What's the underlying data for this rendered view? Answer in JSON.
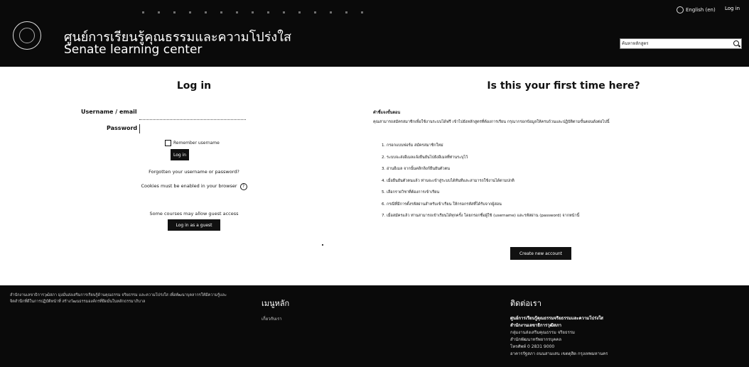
{
  "header": {
    "title_th": "ศูนย์การเรียนรู้คุณธรรมและความโปร่งใส",
    "title_en": "Senate learning center",
    "language": "English (en)",
    "login": "Log in",
    "search_placeholder": "ค้นหาหลักสูตร"
  },
  "login": {
    "heading": "Log in",
    "username_label": "Username / email",
    "password_label": "Password",
    "remember": "Remember username",
    "button": "Log in",
    "forgot": "Forgotten your username or password?",
    "cookies": "Cookies must be enabled in your browser",
    "guest_note": "Some courses may allow guest access",
    "guest_button": "Log in as a guest"
  },
  "signup": {
    "heading": "Is this your first time here?",
    "instructions_title": "คำชี้แจงขั้นตอน",
    "intro": "คุณสามารถสมัครสมาชิกเพื่อใช้งานระบบได้ฟรี เข้าไปยังหลักสูตรที่ต้องการเรียน กรุณากรอกข้อมูลให้ครบถ้วนและปฏิบัติตามขั้นตอนดังต่อไปนี้",
    "steps": [
      "1. กรอกแบบฟอร์ม สมัครสมาชิกใหม่",
      "2. ระบบจะส่งอีเมลแจ้งยืนยันไปยังอีเมลที่ท่านระบุไว้",
      "3. อ่านอีเมล จากนั้นคลิกลิงก์ยืนยันตัวตน",
      "4. เมื่อยืนยันตัวตนแล้ว ท่านจะเข้าสู่ระบบได้ทันทีและสามารถใช้งานได้ตามปกติ",
      "5. เลือกรายวิชาที่ต้องการเข้าเรียน",
      "6. กรณีที่มีการตั้งรหัสผ่านสำหรับเข้าเรียน ให้กรอกรหัสที่ได้รับจากผู้สอน",
      "7. เมื่อสมัครแล้ว ท่านสามารถเข้าเรียนได้ทุกครั้ง โดยกรอกชื่อผู้ใช้ (username) และรหัสผ่าน (password) จากหน้านี้"
    ],
    "button": "Create new account"
  },
  "footer": {
    "about": "สำนักงานเลขาธิการวุฒิสภา มุ่งมั่นส่งเสริมการเรียนรู้ด้านคุณธรรม จริยธรรม และความโปร่งใส เพื่อพัฒนาบุคลากรให้มีความรู้และจิตสำนึกที่ดีในการปฏิบัติหน้าที่ สร้างวัฒนธรรมองค์กรที่ยึดมั่นในหลักธรรมาภิบาล",
    "menu_heading": "เมนูหลัก",
    "menu_item": "เกี่ยวกับเรา",
    "contact_heading": "ติดต่อเรา",
    "contact_name": "ศูนย์การเรียนรู้คุณธรรมจริยธรรมและความโปร่งใส",
    "contact_org": "สำนักงานเลขาธิการวุฒิสภา",
    "contact_line1": "กลุ่มงานส่งเสริมคุณธรรม จริยธรรม",
    "contact_line2": "สำนักพัฒนาทรัพยากรบุคคล",
    "contact_line3": "โทรศัพท์ 0 2831 9000",
    "contact_line4": "อาคารรัฐสภา ถนนสามเสน เขตดุสิต กรุงเทพมหานคร"
  }
}
